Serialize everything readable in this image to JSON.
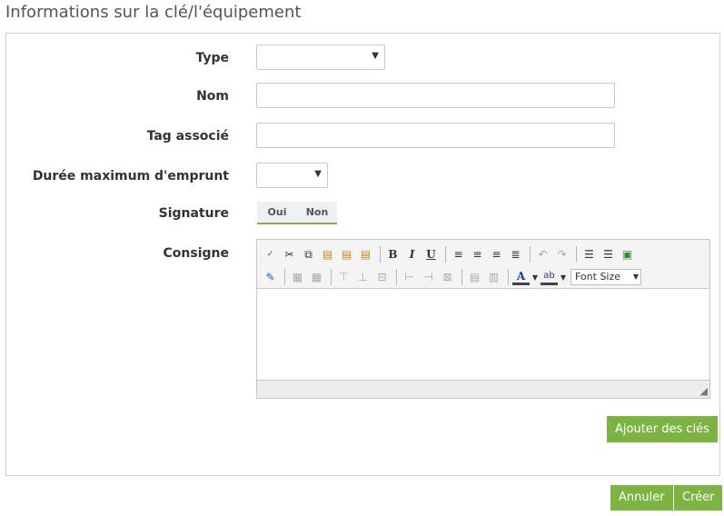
{
  "page": {
    "title": "Informations sur la clé/l'équipement"
  },
  "form": {
    "type_label": "Type",
    "type_value": "",
    "nom_label": "Nom",
    "nom_value": "",
    "tag_label": "Tag associé",
    "tag_value": "",
    "duree_label": "Durée maximum d'emprunt",
    "duree_value": "",
    "signature_label": "Signature",
    "signature_options": [
      "Oui",
      "Non"
    ],
    "consigne_label": "Consigne"
  },
  "editor": {
    "font_size_label": "Font Size",
    "toolbar_row1": [
      "spellcheck-icon",
      "cut-icon",
      "copy-icon",
      "paste-icon",
      "paste-word-icon",
      "paste-text-icon",
      "bold-icon",
      "italic-icon",
      "underline-icon",
      "align-left-icon",
      "align-center-icon",
      "align-right-icon",
      "align-justify-icon",
      "undo-icon",
      "redo-icon",
      "bullet-list-icon",
      "numbered-list-icon",
      "image-icon"
    ],
    "toolbar_row2": [
      "edit-source-icon",
      "table-icon",
      "table-props-icon",
      "row-before-icon",
      "row-after-icon",
      "delete-row-icon",
      "col-before-icon",
      "col-after-icon",
      "delete-col-icon",
      "merge-cells-icon",
      "split-cells-icon",
      "font-color-icon",
      "highlight-color-icon"
    ],
    "content": ""
  },
  "buttons": {
    "add_keys": "Ajouter des clés",
    "cancel": "Annuler",
    "create": "Créer"
  },
  "colors": {
    "accent": "#7cb342",
    "border": "#c8c8c8"
  }
}
